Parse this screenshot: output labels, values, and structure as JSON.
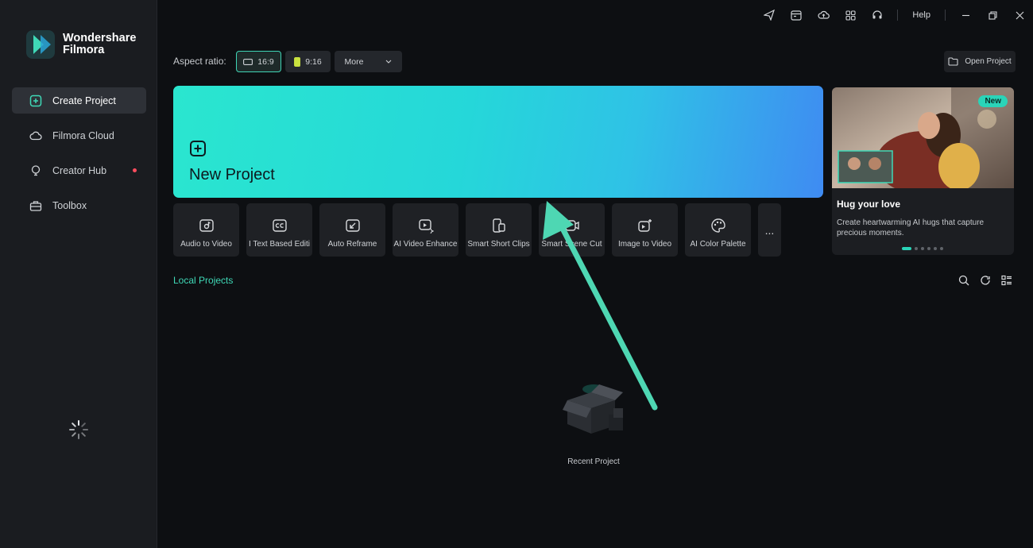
{
  "app": {
    "brand_line1": "Wondershare",
    "brand_line2": "Filmora"
  },
  "sidebar": {
    "items": [
      {
        "label": "Create Project",
        "icon": "plus-square-icon",
        "active": true
      },
      {
        "label": "Filmora Cloud",
        "icon": "cloud-icon"
      },
      {
        "label": "Creator Hub",
        "icon": "bulb-icon",
        "badge": "red-dot"
      },
      {
        "label": "Toolbox",
        "icon": "toolbox-icon"
      }
    ]
  },
  "topbar": {
    "help": "Help"
  },
  "aspect": {
    "label": "Aspect ratio:",
    "options": [
      "16:9",
      "9:16"
    ],
    "selected": "16:9",
    "more": "More"
  },
  "open_project": "Open Project",
  "new_project": {
    "label": "New Project"
  },
  "tools": [
    {
      "label": "Audio to Video",
      "icon": "audio-to-video-icon"
    },
    {
      "label": "I Text Based Editi",
      "icon": "cc-icon"
    },
    {
      "label": "Auto Reframe",
      "icon": "reframe-icon"
    },
    {
      "label": "AI Video Enhance",
      "icon": "enhance-icon"
    },
    {
      "label": "Smart Short Clips",
      "icon": "short-clips-icon"
    },
    {
      "label": "Smart Scene Cut",
      "icon": "scene-cut-icon"
    },
    {
      "label": "Image to Video",
      "icon": "image-to-video-icon"
    },
    {
      "label": "AI Color Palette",
      "icon": "palette-icon"
    }
  ],
  "tools_more": "...",
  "promo": {
    "badge": "New",
    "title": "Hug your love",
    "description": "Create heartwarming AI hugs that capture precious moments."
  },
  "local": {
    "title": "Local Projects",
    "empty_label": "Recent Project"
  },
  "colors": {
    "accent": "#3fd9b7",
    "banner_start": "#2ae6cf",
    "banner_end": "#3f8bf2",
    "background": "#0d0f12"
  }
}
